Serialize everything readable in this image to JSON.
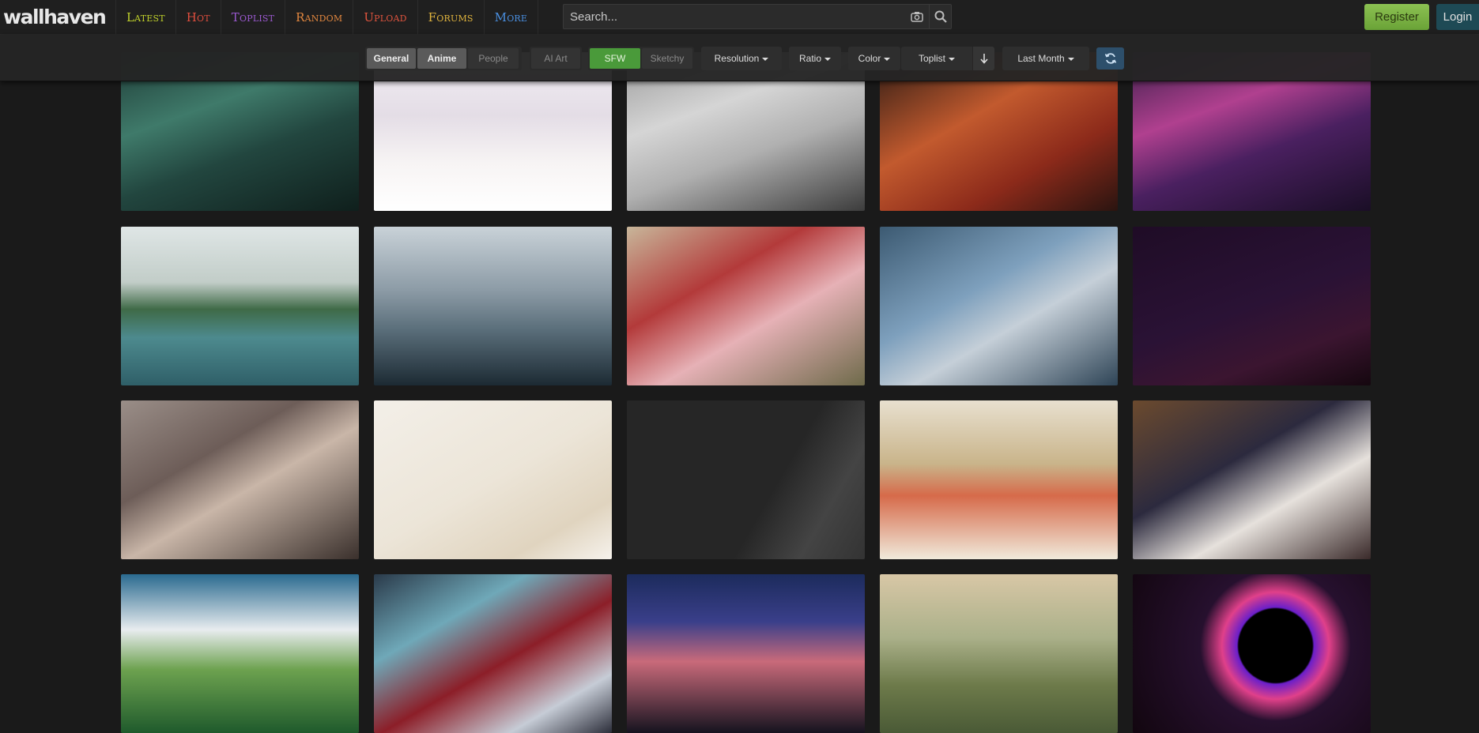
{
  "header": {
    "logo": "wallhaven",
    "nav": [
      {
        "label": "Latest",
        "color": "#c1d22b"
      },
      {
        "label": "Hot",
        "color": "#e04e3e"
      },
      {
        "label": "Toplist",
        "color": "#9b59d0"
      },
      {
        "label": "Random",
        "color": "#e2873f"
      },
      {
        "label": "Upload",
        "color": "#e0543e"
      },
      {
        "label": "Forums",
        "color": "#e0b43e"
      },
      {
        "label": "More",
        "color": "#4a8fe0"
      }
    ],
    "search_placeholder": "Search...",
    "register_label": "Register",
    "login_label": "Login"
  },
  "filters": {
    "categories": [
      {
        "label": "General",
        "active": true
      },
      {
        "label": "Anime",
        "active": true
      },
      {
        "label": "People",
        "active": false
      }
    ],
    "ai_art": "AI Art",
    "purity": [
      {
        "label": "SFW",
        "active": true
      },
      {
        "label": "Sketchy",
        "active": false
      }
    ],
    "resolution": "Resolution",
    "ratio": "Ratio",
    "color": "Color",
    "sort": "Toplist",
    "range": "Last Month"
  },
  "thumbnails": [
    {
      "name": "thumb-castle-cliff",
      "bg": "linear-gradient(160deg,#1e3b36 0%,#3f7a6a 35%,#22463f 60%,#0f1f1c 100%)"
    },
    {
      "name": "thumb-anime-white-dress",
      "bg": "linear-gradient(180deg,#f2eff4 0%,#e4dde6 40%,#f7f4f4 70%,#ffffff 100%)"
    },
    {
      "name": "thumb-retro-computer",
      "bg": "linear-gradient(160deg,#9a9a9a 0%,#d5d5d5 35%,#b0b0b0 60%,#3c3c3c 100%)"
    },
    {
      "name": "thumb-woman-phone-red",
      "bg": "linear-gradient(150deg,#2a1a14 0%,#c25a2e 40%,#8c2a1a 70%,#2a1410 100%)"
    },
    {
      "name": "thumb-purple-room",
      "bg": "linear-gradient(160deg,#3a1f4a 0%,#b0408f 35%,#4a2060 60%,#1a0e26 100%)"
    },
    {
      "name": "thumb-mountain-lake",
      "bg": "linear-gradient(180deg,#dfe6e6 0%,#c2cdc8 35%,#3f6a47 52%,#4d8a8e 70%,#2f5f68 100%)"
    },
    {
      "name": "thumb-ocean-vortex",
      "bg": "linear-gradient(180deg,#c9d2d8 0%,#8c9ba6 40%,#5a6e7a 65%,#1c2a33 100%)"
    },
    {
      "name": "thumb-girl-lilies",
      "bg": "linear-gradient(150deg,#c8b69a 0%,#b33a3a 35%,#e6b1b6 60%,#6e6a4a 100%)"
    },
    {
      "name": "thumb-elf-profile",
      "bg": "linear-gradient(150deg,#3c5a72 0%,#7ea0bd 40%,#c5cfd8 60%,#2e4456 100%)"
    },
    {
      "name": "thumb-astronaut-space",
      "bg": "linear-gradient(160deg,#1f0c26 0%,#2a1235 50%,#3b1530 75%,#15070f 100%)"
    },
    {
      "name": "thumb-armor-roses",
      "bg": "linear-gradient(150deg,#9a8e88 0%,#6d5d58 35%,#c9b6a8 55%,#3a302c 100%)"
    },
    {
      "name": "thumb-warrior-sketch",
      "bg": "linear-gradient(150deg,#f3efe8 0%,#ece5d8 50%,#e0d4bf 80%,#f6f2ec 100%)"
    },
    {
      "name": "thumb-dark-gray-girl",
      "bg": "linear-gradient(120deg,#262626 0%,#262626 60%,#444 80%,#333 100%)"
    },
    {
      "name": "thumb-pokemon-crowd",
      "bg": "linear-gradient(180deg,#e8e0cf 0%,#c9b48a 40%,#d66a4a 60%,#f0eadb 100%)"
    },
    {
      "name": "thumb-sitting-girl-library",
      "bg": "linear-gradient(150deg,#6b4a2e 0%,#2c2a3e 40%,#e6e1dc 65%,#3a2a2a 100%)"
    },
    {
      "name": "thumb-ghibli-grass",
      "bg": "linear-gradient(180deg,#2a6a8f 0%,#e8ecef 35%,#6da24f 60%,#1f5a2c 100%)"
    },
    {
      "name": "thumb-red-gothic-girl",
      "bg": "linear-gradient(150deg,#2a3a4a 0%,#6fa8b8 30%,#8c1e28 55%,#c6ccd6 80%,#2c2e3a 100%)"
    },
    {
      "name": "thumb-sunset-city",
      "bg": "linear-gradient(180deg,#1c2b5c 0%,#3a3f8a 30%,#c96a7a 55%,#15131f 100%)"
    },
    {
      "name": "thumb-forest-adventurer",
      "bg": "linear-gradient(180deg,#d8c7a6 0%,#aab089 40%,#6d7a4a 70%,#4a5a36 100%)"
    },
    {
      "name": "thumb-black-hole-neon",
      "bg": "radial-gradient(circle at 60% 45%,#000 0 22%,#6a1fc9 23%,#e0408a 32%,#26102e 45%,#12060f 100%)"
    }
  ]
}
